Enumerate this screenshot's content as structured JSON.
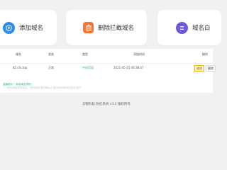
{
  "cards": [
    {
      "label": "添加域名",
      "icon": "add-icon",
      "color": "#2d8cf0"
    },
    {
      "label": "删除拦截域名",
      "icon": "delete-icon",
      "color": "#f97535"
    },
    {
      "label": "域名白",
      "icon": "list-icon",
      "color": "#6b5bd6"
    }
  ],
  "table": {
    "headers": [
      "域名",
      "状态",
      "类型",
      "添加时间",
      "操作"
    ],
    "rows": [
      {
        "domain": "85.cfu.top",
        "status": "正常",
        "type": "中间页面",
        "added": "2021-05-25 06:38:47",
        "actions": [
          "编辑",
          "删除"
        ]
      }
    ]
  },
  "notes": [
    "温馨提示：添加域名须知！",
    "1、请勿添加违规域名，防红域名请先确认正常访问后再添加防红保护"
  ],
  "footer": "云锦科技 防红系统 v3.2 版权所有"
}
